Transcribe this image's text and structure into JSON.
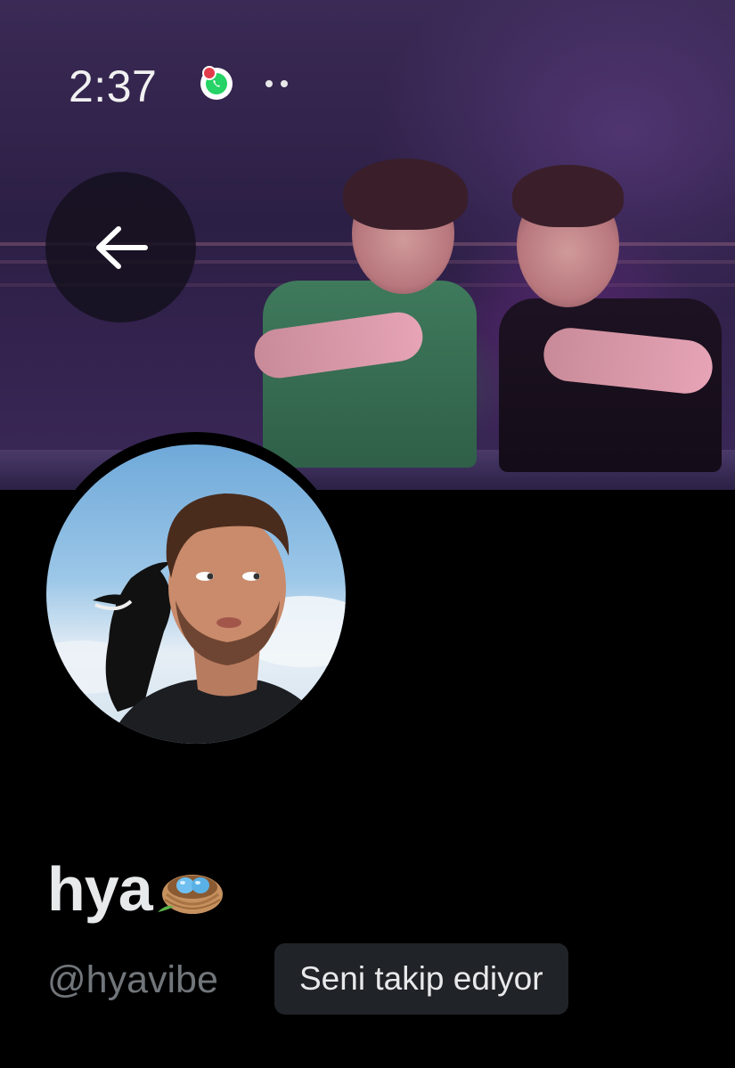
{
  "status_bar": {
    "time": "2:37",
    "notification_icons": [
      "whatsapp-icon",
      "more-dots-icon"
    ]
  },
  "header": {
    "back_icon": "arrow-left-icon"
  },
  "profile": {
    "display_name": "hya",
    "name_emoji": "nest-with-eggs-icon",
    "handle": "@hyavibe",
    "follows_you_label": "Seni takip ediyor"
  },
  "colors": {
    "background": "#000000",
    "primary_text": "#e7e9ea",
    "secondary_text": "#71767b",
    "badge_background": "#202327"
  }
}
